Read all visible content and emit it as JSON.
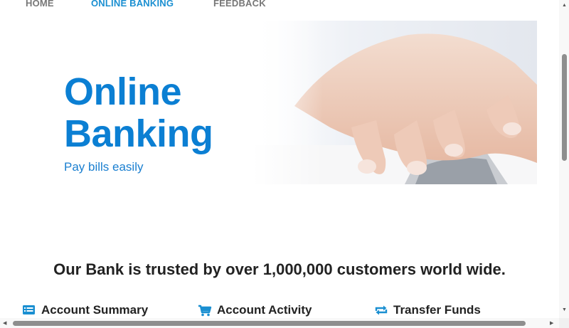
{
  "nav": {
    "items": [
      {
        "label": "HOME",
        "active": false
      },
      {
        "label": "ONLINE BANKING",
        "active": true
      },
      {
        "label": "FEEDBACK",
        "active": false
      }
    ]
  },
  "hero": {
    "title_line1": "Online",
    "title_line2": "Banking",
    "subtitle": "Pay bills easily"
  },
  "trusted_text": "Our Bank is trusted by over 1,000,000 customers world wide.",
  "features": [
    {
      "label": "Account Summary",
      "icon": "list-icon"
    },
    {
      "label": "Account Activity",
      "icon": "cart-icon"
    },
    {
      "label": "Transfer Funds",
      "icon": "transfer-arrows-icon"
    }
  ],
  "colors": {
    "accent": "#0b7fd3",
    "nav_inactive": "#777777",
    "text_dark": "#222222"
  }
}
